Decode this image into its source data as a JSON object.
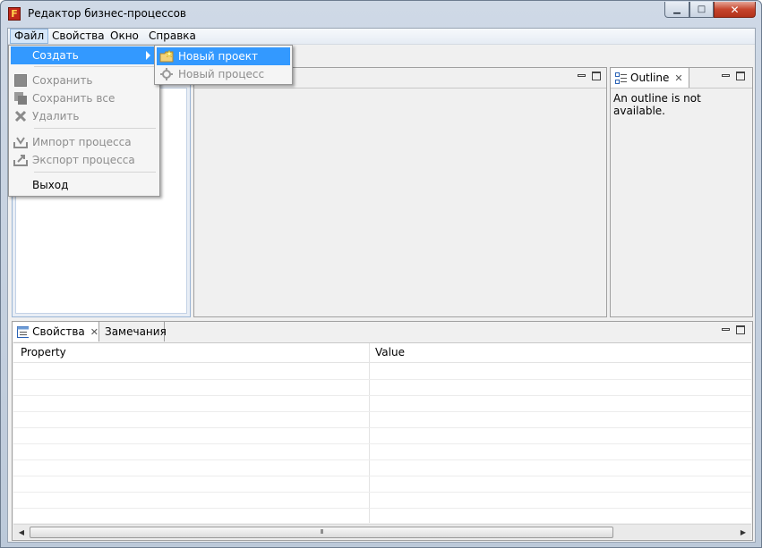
{
  "window": {
    "title": "Редактор бизнес-процессов",
    "app_icon_letter": "F",
    "controls": {
      "minimize": "▁",
      "maximize": "□",
      "close": "✕"
    }
  },
  "menubar": {
    "items": [
      {
        "label": "Файл"
      },
      {
        "label": "Свойства"
      },
      {
        "label": "Окно"
      },
      {
        "label": "Справка"
      }
    ]
  },
  "file_menu": {
    "items": [
      {
        "label": "Создать",
        "state": "highlighted"
      },
      {
        "label": "Сохранить",
        "state": "disabled"
      },
      {
        "label": "Сохранить все",
        "state": "disabled"
      },
      {
        "label": "Удалить",
        "state": "disabled"
      },
      {
        "label": "Импорт процесса",
        "state": "disabled"
      },
      {
        "label": "Экспорт процесса",
        "state": "disabled"
      },
      {
        "label": "Выход",
        "state": "enabled"
      }
    ],
    "submenu": [
      {
        "label": "Новый проект",
        "state": "highlighted"
      },
      {
        "label": "Новый процесс",
        "state": "disabled"
      }
    ]
  },
  "outline": {
    "tab_label": "Outline",
    "message": "An outline is not available."
  },
  "bottom_panel": {
    "tabs": [
      {
        "label": "Свойства",
        "active": true
      },
      {
        "label": "Замечания",
        "active": false
      }
    ],
    "columns": [
      "Property",
      "Value"
    ],
    "scroll_thumb_grip": "III"
  },
  "colors": {
    "menu_highlight": "#3399ff",
    "disabled_text": "#8d8d8d",
    "panel_bg": "#f0f0f0"
  }
}
